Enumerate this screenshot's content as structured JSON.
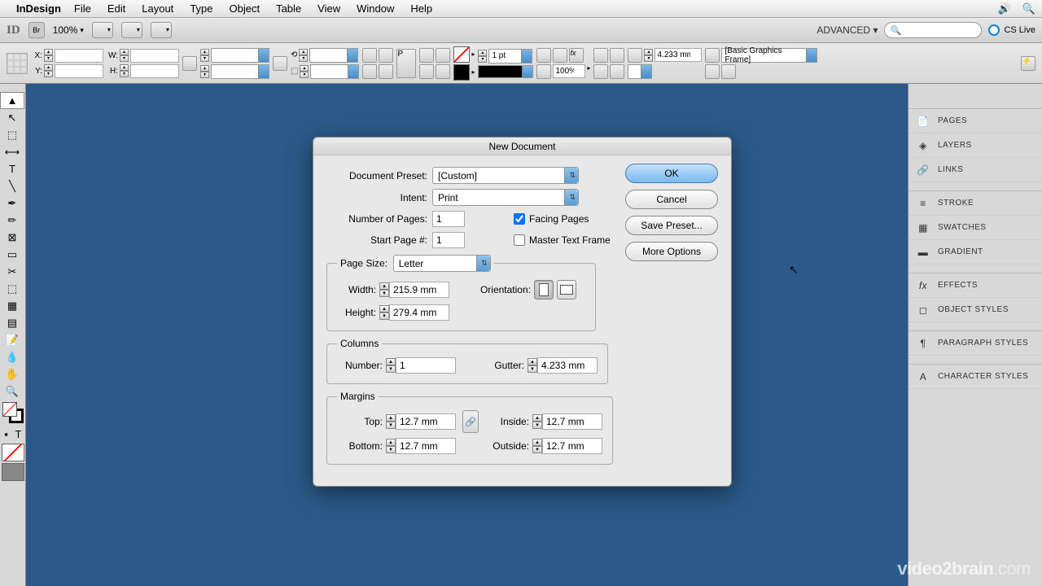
{
  "menubar": {
    "appname": "InDesign",
    "items": [
      "File",
      "Edit",
      "Layout",
      "Type",
      "Object",
      "Table",
      "View",
      "Window",
      "Help"
    ]
  },
  "apptoolbar": {
    "zoom": "100%",
    "advanced": "ADVANCED",
    "cslive": "CS Live"
  },
  "controlbar": {
    "x_label": "X:",
    "y_label": "Y:",
    "w_label": "W:",
    "h_label": "H:",
    "stroke_weight": "1 pt",
    "opacity": "100%",
    "corner": "4.233 mm",
    "style_preset": "[Basic Graphics Frame]"
  },
  "panels": {
    "g1": [
      "PAGES",
      "LAYERS",
      "LINKS"
    ],
    "g2": [
      "STROKE",
      "SWATCHES",
      "GRADIENT"
    ],
    "g3": [
      "EFFECTS",
      "OBJECT STYLES"
    ],
    "g4": [
      "PARAGRAPH STYLES"
    ],
    "g5": [
      "CHARACTER STYLES"
    ]
  },
  "dialog": {
    "title": "New Document",
    "preset_label": "Document Preset:",
    "preset_value": "[Custom]",
    "intent_label": "Intent:",
    "intent_value": "Print",
    "num_pages_label": "Number of Pages:",
    "num_pages": "1",
    "start_page_label": "Start Page #:",
    "start_page": "1",
    "facing_pages": "Facing Pages",
    "master_frame": "Master Text Frame",
    "page_size_legend": "Page Size:",
    "page_size_value": "Letter",
    "width_label": "Width:",
    "width": "215.9 mm",
    "height_label": "Height:",
    "height": "279.4 mm",
    "orientation_label": "Orientation:",
    "columns_legend": "Columns",
    "col_number_label": "Number:",
    "col_number": "1",
    "gutter_label": "Gutter:",
    "gutter": "4.233 mm",
    "margins_legend": "Margins",
    "top_label": "Top:",
    "top": "12.7 mm",
    "bottom_label": "Bottom:",
    "bottom": "12.7 mm",
    "inside_label": "Inside:",
    "inside": "12.7 mm",
    "outside_label": "Outside:",
    "outside": "12.7 mm",
    "ok": "OK",
    "cancel": "Cancel",
    "save_preset": "Save Preset...",
    "more_options": "More Options"
  },
  "watermark": {
    "brand": "video2brain",
    "tld": ".com"
  }
}
